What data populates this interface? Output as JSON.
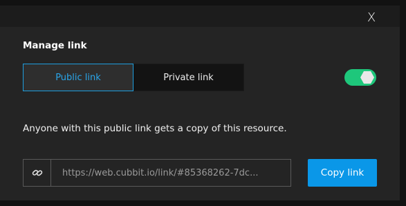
{
  "dialog": {
    "close_label": "X",
    "title": "Manage link",
    "tabs": [
      {
        "label": "Public link",
        "active": true
      },
      {
        "label": "Private link",
        "active": false
      }
    ],
    "toggle": {
      "enabled": true,
      "on_color": "#1ec77b"
    },
    "description": "Anyone with this public link gets a copy of this resource.",
    "link_field": {
      "icon": "link-icon",
      "value": "https://web.cubbit.io/link/#85368262-7dc..."
    },
    "copy_button_label": "Copy link"
  },
  "colors": {
    "accent": "#0a97e8",
    "active_tab_text": "#2aa6ea",
    "background": "#242424"
  }
}
